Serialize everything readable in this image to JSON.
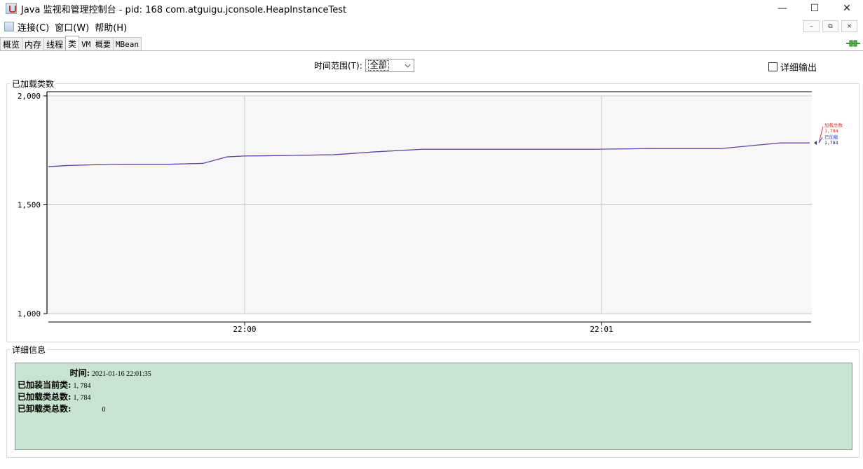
{
  "window": {
    "title": "Java 监视和管理控制台 - pid: 168 com.atguigu.jconsole.HeapInstanceTest",
    "minimize": "—",
    "maximize": "☐",
    "close": "✕"
  },
  "menu": {
    "items": [
      "连接(C)",
      "窗口(W)",
      "帮助(H)"
    ],
    "inner_minimize": "–",
    "inner_restore": "⧉",
    "inner_close": "×"
  },
  "tabs": [
    "概览",
    "内存",
    "线程",
    "类",
    "VM 概要",
    "MBean"
  ],
  "active_tab": "类",
  "controls": {
    "time_range_label": "时间范围(T):",
    "time_range_value": "全部",
    "detail_output_label": "详细输出",
    "detail_output_checked": false
  },
  "chart_panel": {
    "title": "已加载类数"
  },
  "chart_data": {
    "type": "line",
    "title": "",
    "ylim": [
      1000,
      2000
    ],
    "yticks": [
      1000,
      1500,
      2000
    ],
    "ytick_labels": [
      "1,000",
      "1,500",
      "2,000"
    ],
    "xticks": [
      "22:00",
      "22:01"
    ],
    "grid": true,
    "colors": {
      "total": "#d9342b",
      "loaded": "#3949c9"
    },
    "series": [
      {
        "name": "加载总数",
        "label_value": "1,784",
        "x": [
          "21:59:27",
          "21:59:30",
          "21:59:35",
          "21:59:40",
          "21:59:47",
          "21:59:53",
          "21:59:57",
          "22:00:00",
          "22:00:07",
          "22:00:15",
          "22:00:22",
          "22:00:30",
          "22:00:37",
          "22:00:45",
          "22:00:52",
          "22:00:59",
          "22:01:07",
          "22:01:12",
          "22:01:16",
          "22:01:20",
          "22:01:30",
          "22:01:35"
        ],
        "values": [
          1675,
          1680,
          1684,
          1686,
          1686,
          1690,
          1720,
          1724,
          1726,
          1730,
          1743,
          1755,
          1755,
          1755,
          1755,
          1755,
          1758,
          1758,
          1758,
          1758,
          1784,
          1784
        ]
      },
      {
        "name": "已加载",
        "label_value": "1,784",
        "x": [
          "21:59:27",
          "21:59:30",
          "21:59:35",
          "21:59:40",
          "21:59:47",
          "21:59:53",
          "21:59:57",
          "22:00:00",
          "22:00:07",
          "22:00:15",
          "22:00:22",
          "22:00:30",
          "22:00:37",
          "22:00:45",
          "22:00:52",
          "22:00:59",
          "22:01:07",
          "22:01:12",
          "22:01:16",
          "22:01:20",
          "22:01:30",
          "22:01:35"
        ],
        "values": [
          1675,
          1680,
          1684,
          1686,
          1686,
          1690,
          1720,
          1724,
          1726,
          1730,
          1743,
          1755,
          1755,
          1755,
          1755,
          1755,
          1758,
          1758,
          1758,
          1758,
          1784,
          1784
        ]
      }
    ]
  },
  "detail_panel": {
    "title": "详细信息",
    "rows": [
      {
        "label": "时间:",
        "value": "2021-01-16 22:01:35"
      },
      {
        "label": "已加装当前类:",
        "value": "1, 784"
      },
      {
        "label": "已加载类总数:",
        "value": "1, 784"
      },
      {
        "label": "已卸载类总数:",
        "value": "0"
      }
    ]
  }
}
